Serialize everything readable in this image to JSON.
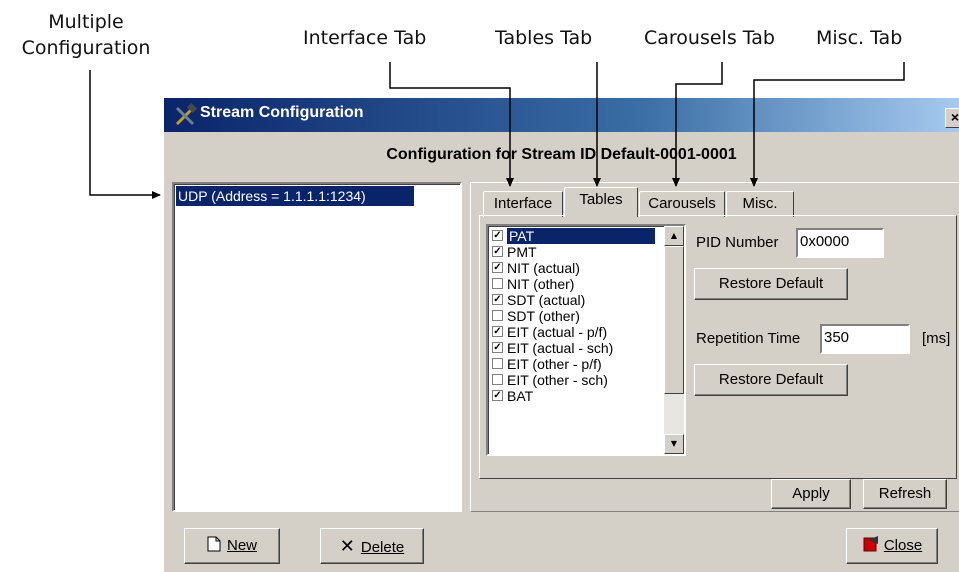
{
  "callouts": {
    "multiple_line1": "Multiple",
    "multiple_line2": "Configuration",
    "interface": "Interface Tab",
    "tables": "Tables Tab",
    "carousels": "Carousels Tab",
    "misc": "Misc. Tab"
  },
  "window": {
    "title": "Stream Configuration",
    "close": "×"
  },
  "heading": "Configuration for Stream ID Default-0001-0001",
  "config_list": {
    "items": [
      {
        "label": "UDP (Address = 1.1.1.1:1234)",
        "selected": true
      }
    ]
  },
  "tabs": [
    {
      "label": "Interface",
      "active": false
    },
    {
      "label": "Tables",
      "active": true
    },
    {
      "label": "Carousels",
      "active": false
    },
    {
      "label": "Misc.",
      "active": false
    }
  ],
  "tables": {
    "items": [
      {
        "label": "PAT",
        "checked": true,
        "selected": true
      },
      {
        "label": "PMT",
        "checked": true
      },
      {
        "label": "NIT (actual)",
        "checked": true
      },
      {
        "label": "NIT (other)",
        "checked": false
      },
      {
        "label": "SDT (actual)",
        "checked": true
      },
      {
        "label": "SDT (other)",
        "checked": false
      },
      {
        "label": "EIT (actual - p/f)",
        "checked": true
      },
      {
        "label": "EIT (actual - sch)",
        "checked": true
      },
      {
        "label": "EIT (other - p/f)",
        "checked": false
      },
      {
        "label": "EIT (other - sch)",
        "checked": false
      },
      {
        "label": "BAT",
        "checked": true
      }
    ]
  },
  "pid": {
    "label": "PID Number",
    "value": "0x0000",
    "restore": "Restore Default"
  },
  "repetition": {
    "label": "Repetition Time",
    "value": "350",
    "unit": "[ms]",
    "restore": "Restore Default"
  },
  "buttons": {
    "apply": "Apply",
    "refresh": "Refresh",
    "new": "New",
    "delete": "Delete",
    "close": "Close"
  },
  "colors": {
    "titlebar": "#0a246a",
    "selection": "#0a246a",
    "dialog": "#d4d0c8"
  }
}
